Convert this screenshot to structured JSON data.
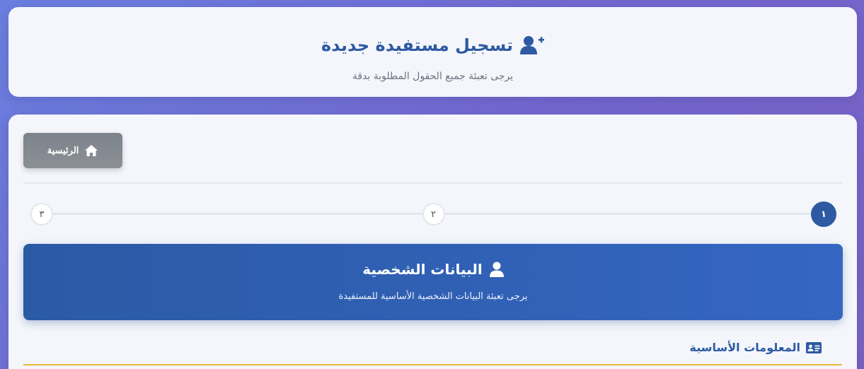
{
  "header": {
    "title": "تسجيل مستفيدة جديدة",
    "title_icon": "user-plus-icon",
    "subtitle": "يرجى تعبئة جميع الحقول المطلوبة بدقة"
  },
  "nav": {
    "home_label": "الرئيسية",
    "home_icon": "home-icon"
  },
  "stepper": {
    "steps": [
      "١",
      "٢",
      "٣"
    ],
    "active_index": 0
  },
  "section": {
    "title": "البيانات الشخصية",
    "title_icon": "user-icon",
    "subtitle": "يرجى تعبئة البيانات الشخصية الأساسية للمستفيدة"
  },
  "subsection": {
    "title": "المعلومات الأساسية",
    "icon": "id-card-icon"
  },
  "colors": {
    "primary": "#2e5aa3",
    "accent": "#e6b93a",
    "muted_button": "#848a91",
    "background_start": "#6a7fe0",
    "background_end": "#7a62c4"
  }
}
